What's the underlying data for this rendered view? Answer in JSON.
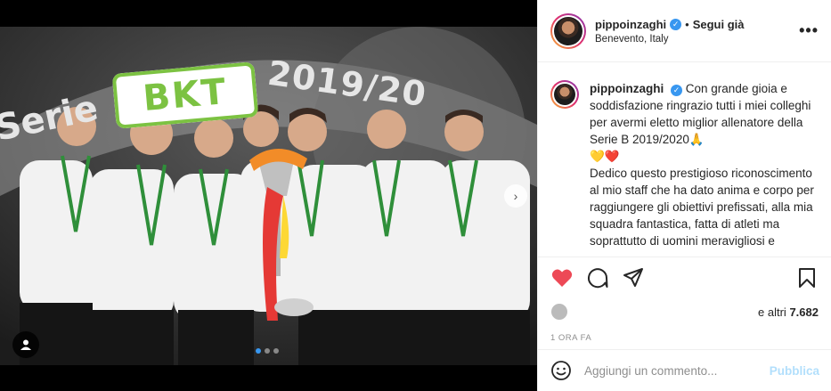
{
  "post": {
    "username": "pippoinzaghi",
    "follow_label": "Segui già",
    "separator": "•",
    "location": "Benevento, Italy",
    "more_label": "•••",
    "verified_mark": "✓"
  },
  "photo": {
    "serie_text": "Serie",
    "brand_text": "BKT",
    "year_text": "2019/20",
    "next_arrow": "›",
    "carousel_dots": 3,
    "active_dot": 0
  },
  "caption": {
    "username": "pippoinzaghi",
    "paragraph1": "Con grande gioia e soddisfazione ringrazio tutti i miei colleghi per avermi eletto miglior allenatore della Serie B 2019/2020🙏",
    "hearts": "💛❤️",
    "paragraph2": "Dedico questo prestigioso riconoscimento al mio staff che ha dato anima e corpo per raggiungere gli obiettivi prefissati, alla mia squadra fantastica, fatta di atleti ma soprattutto di uomini meravigliosi e"
  },
  "likes": {
    "prefix": "e altri",
    "count": "7.682"
  },
  "timestamp": "1 ORA FA",
  "comment_box": {
    "placeholder": "Aggiungi un commento...",
    "publish_label": "Pubblica"
  },
  "colors": {
    "accent_blue": "#3897f0",
    "publish_disabled": "#b2dffc",
    "like_red": "#ed4956",
    "muted": "#8e8e8e"
  }
}
